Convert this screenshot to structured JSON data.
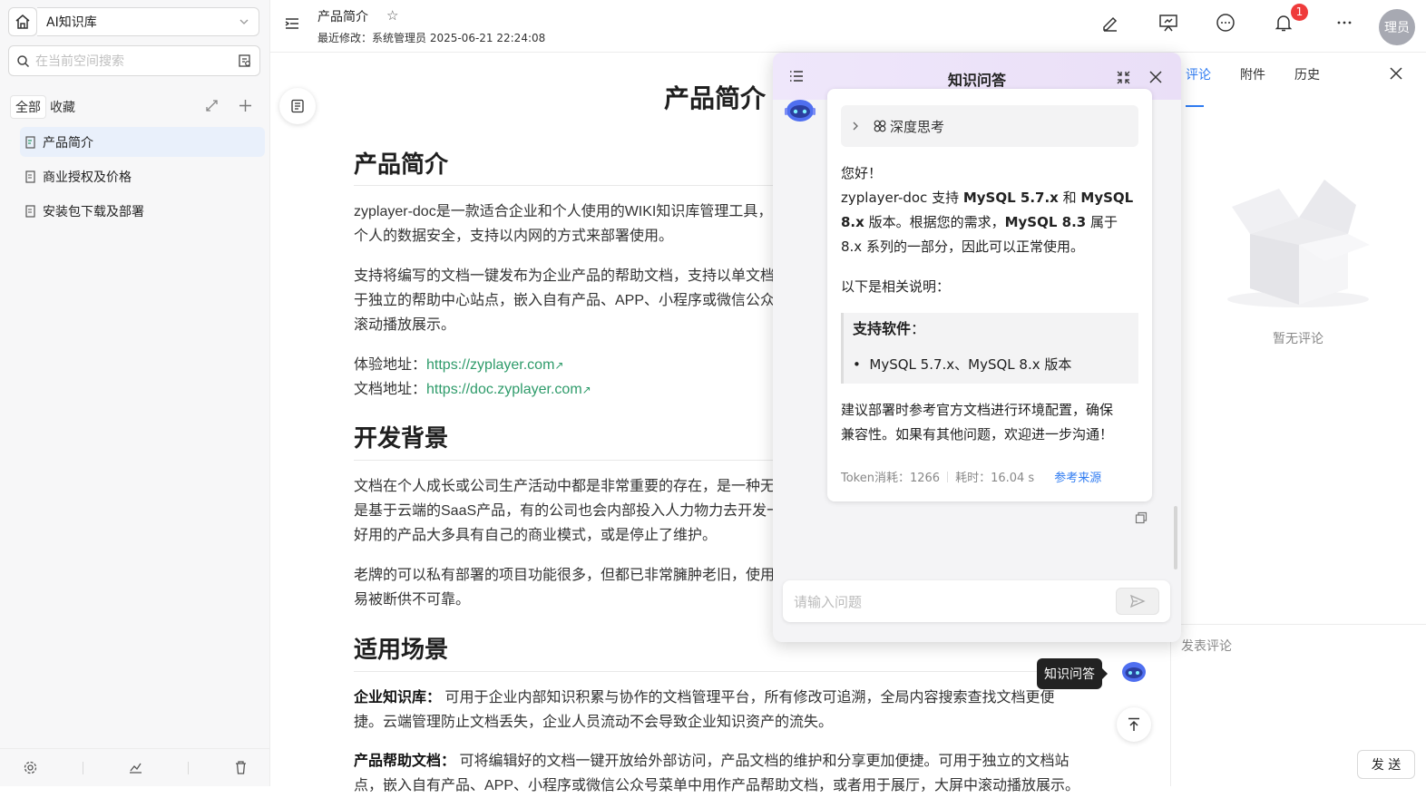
{
  "sidebar": {
    "space_name": "AI知识库",
    "search_placeholder": "在当前空间搜索",
    "tabs": [
      "全部",
      "收藏"
    ],
    "items": [
      {
        "label": "产品简介",
        "active": true
      },
      {
        "label": "商业授权及价格",
        "active": false
      },
      {
        "label": "安装包下载及部署",
        "active": false
      }
    ]
  },
  "header": {
    "doc_title": "产品简介",
    "modified": "最近修改：系统管理员  2025-06-21 22:24:08",
    "notification_count": "1",
    "avatar_text": "理员"
  },
  "doc": {
    "title": "产品简介",
    "h2_intro": "产品简介",
    "p1": "zyplayer-doc是一款适合企业和个人使用的WIKI知识库管理工具，",
    "p1b": "个人的数据安全，支持以内网的方式来部署使用。",
    "p2": "支持将编写的文档一键发布为企业产品的帮助文档，支持以单文档",
    "p2b": "于独立的帮助中心站点，嵌入自有产品、APP、小程序或微信公众",
    "p2c": "滚动播放展示。",
    "demo_label": "体验地址：",
    "demo_url": "https://zyplayer.com",
    "docs_label": "文档地址：",
    "docs_url": "https://doc.zyplayer.com",
    "h2_bg": "开发背景",
    "p3": "文档在个人成长或公司生产活动中都是非常重要的存在，是一种无",
    "p3b": "是基于云端的SaaS产品，有的公司也会内部投入人力物力去开发一",
    "p3c": "好用的产品大多具有自己的商业模式，或是停止了维护。",
    "p4": "老牌的可以私有部署的项目功能很多，但都已非常臃肿老旧，使用",
    "p4b": "易被断供不可靠。",
    "h2_scene": "适用场景",
    "scene1_label": "企业知识库：",
    "scene1": "可用于企业内部知识积累与协作的文档管理平台，所有修改可追溯，全局内容搜索查找文档更便",
    "scene1b": "捷。云端管理防止文档丢失，企业人员流动不会导致企业知识资产的流失。",
    "scene2_label": "产品帮助文档：",
    "scene2": "可将编辑好的文档一键开放给外部访问，产品文档的维护和分享更加便捷。可用于独立的文档站",
    "scene2b": "点，嵌入自有产品、APP、小程序或微信公众号菜单中用作产品帮助文档，或者用于展厅，大屏中滚动播放展示。"
  },
  "comments": {
    "tabs": [
      "评论",
      "附件",
      "历史"
    ],
    "empty": "暂无评论",
    "post_label": "发表评论",
    "send": "发 送"
  },
  "qa": {
    "title": "知识问答",
    "think_label": "深度思考",
    "greeting": "您好！",
    "answer_line1_pre": "zyplayer-doc 支持 ",
    "answer_b1": "MySQL 5.7.x",
    "answer_mid": " 和 ",
    "answer_b2": "MySQL",
    "answer_line2_b": "8.x",
    "answer_line2": " 版本。根据您的需求，",
    "answer_b3": "MySQL 8.3",
    "answer_line2_end": " 属于",
    "answer_line3": "8.x 系列的一部分，因此可以正常使用。",
    "explain": "以下是相关说明：",
    "quote_title": "支持软件",
    "quote_colon": "：",
    "quote_item": "MySQL 5.7.x、MySQL 8.x 版本",
    "advice1": "建议部署时参考官方文档进行环境配置，确保",
    "advice2": "兼容性。如果有其他问题，欢迎进一步沟通！",
    "token": "Token消耗：1266",
    "time": "耗时：16.04 s",
    "refs": "参考来源",
    "input_placeholder": "请输入问题",
    "tooltip": "知识问答"
  },
  "colors": {
    "accent": "#2f7bf1",
    "link": "#2e9b6a",
    "badge": "#ef3b3b"
  }
}
